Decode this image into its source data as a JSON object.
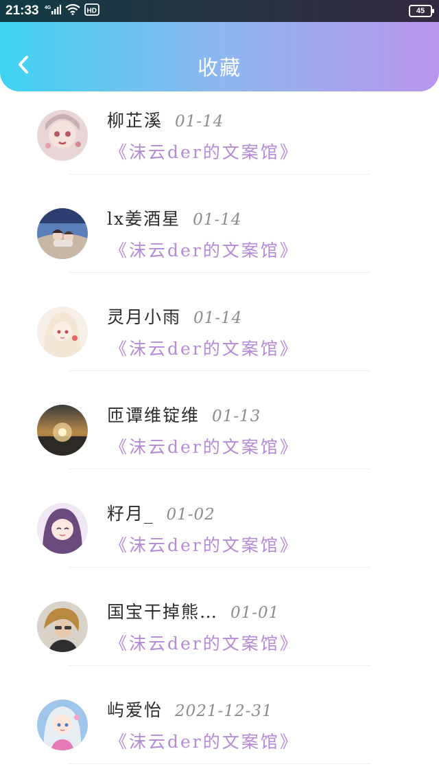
{
  "status_bar": {
    "time": "21:33",
    "network": "4G",
    "hd_label": "HD",
    "battery": "45"
  },
  "header": {
    "title": "收藏",
    "back_icon": "chevron-left-icon",
    "gradient": [
      "#3fd3f2",
      "#b996ec"
    ]
  },
  "colors": {
    "source_text": "#b48ad8",
    "name_text": "#2b2b2b",
    "date_text": "#8c8c8c"
  },
  "favorites": [
    {
      "name": "柳芷溪",
      "date": "01-14",
      "source": "《沫云der的文案馆》",
      "avatar": "avatar-girl-pink-face"
    },
    {
      "name": "lx姜酒星",
      "date": "01-14",
      "source": "《沫云der的文案馆》",
      "avatar": "avatar-beach-photo"
    },
    {
      "name": "灵月小雨",
      "date": "01-14",
      "source": "《沫云der的文案馆》",
      "avatar": "avatar-white-hair-girl"
    },
    {
      "name": "匝谭维锭维",
      "date": "01-13",
      "source": "《沫云der的文案馆》",
      "avatar": "avatar-sunset-sphere"
    },
    {
      "name": "籽月_",
      "date": "01-02",
      "source": "《沫云der的文案馆》",
      "avatar": "avatar-purple-hair-girl"
    },
    {
      "name": "国宝干掉熊…",
      "date": "01-01",
      "source": "《沫云der的文案馆》",
      "avatar": "avatar-blonde-boy"
    },
    {
      "name": "屿爱怡",
      "date": "2021-12-31",
      "source": "《沫云der的文案馆》",
      "avatar": "avatar-blue-hair-girl"
    }
  ]
}
